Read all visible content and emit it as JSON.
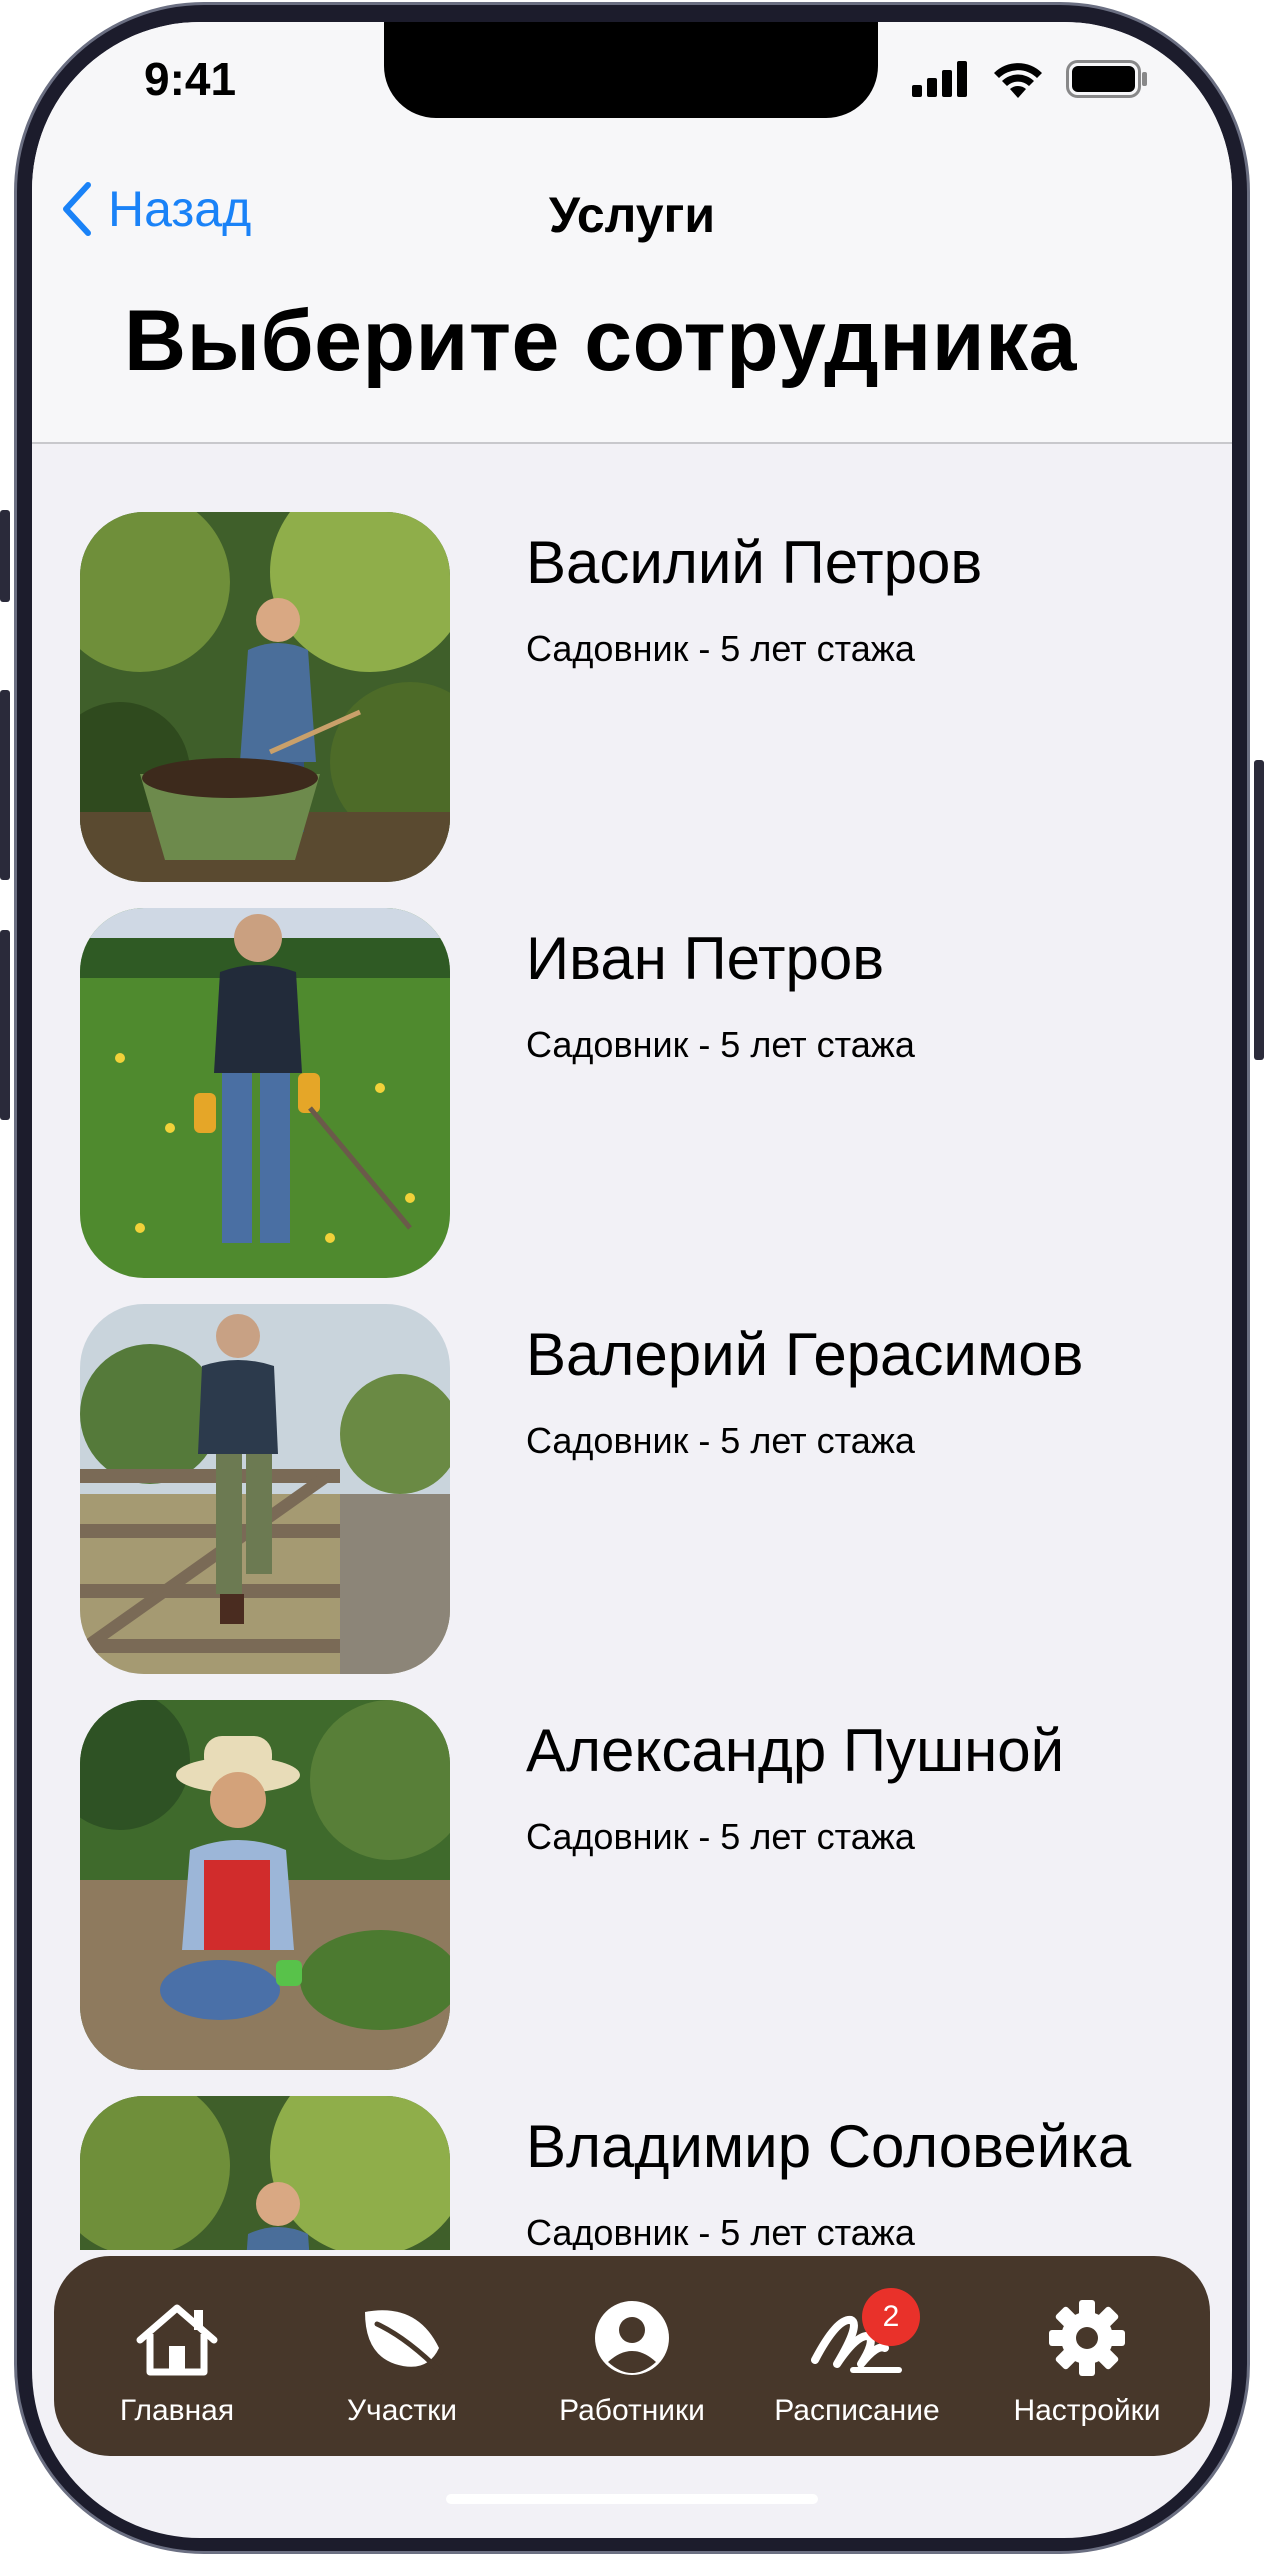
{
  "status_bar": {
    "time": "9:41"
  },
  "nav": {
    "back_label": "Назад",
    "title": "Услуги"
  },
  "page": {
    "title": "Выберите сотрудника"
  },
  "employees": [
    {
      "name": "Василий Петров",
      "role": "Садовник - 5 лет стажа"
    },
    {
      "name": "Иван Петров",
      "role": "Садовник - 5 лет стажа"
    },
    {
      "name": "Валерий Герасимов",
      "role": "Садовник - 5 лет стажа"
    },
    {
      "name": "Александр Пушной",
      "role": "Садовник - 5 лет стажа"
    },
    {
      "name": "Владимир Соловейка",
      "role": "Садовник - 5 лет стажа"
    }
  ],
  "tabbar": {
    "items": [
      {
        "label": "Главная",
        "icon": "house-icon"
      },
      {
        "label": "Участки",
        "icon": "leaf-icon"
      },
      {
        "label": "Работники",
        "icon": "person-circle-icon"
      },
      {
        "label": "Расписание",
        "icon": "signature-icon",
        "badge": "2"
      },
      {
        "label": "Настройки",
        "icon": "gear-icon"
      }
    ]
  },
  "colors": {
    "accent": "#1a82f7",
    "tabbar_bg": "#47372a",
    "badge": "#e9312a",
    "background": "#f2f1f6"
  }
}
